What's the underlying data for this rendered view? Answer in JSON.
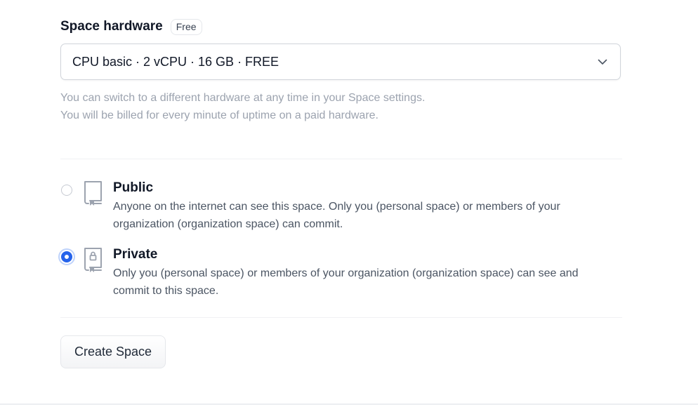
{
  "hardware": {
    "title": "Space hardware",
    "badge": "Free",
    "selected": "CPU basic · 2 vCPU · 16 GB · FREE",
    "chevron_icon": "chevron-down-icon",
    "help_line_1": "You can switch to a different hardware at any time in your Space settings.",
    "help_line_2": "You will be billed for every minute of uptime on a paid hardware."
  },
  "visibility": {
    "options": [
      {
        "label": "Public",
        "description": "Anyone on the internet can see this space. Only you (personal space) or members of your organization (organization space) can commit.",
        "icon": "book-icon",
        "selected": false
      },
      {
        "label": "Private",
        "description": "Only you (personal space) or members of your organization (organization space) can see and commit to this space.",
        "icon": "locked-book-icon",
        "selected": true
      }
    ]
  },
  "actions": {
    "create_label": "Create Space"
  },
  "colors": {
    "accent": "#2563eb",
    "muted_text": "#9ca3af",
    "body_text": "#4b5563"
  }
}
